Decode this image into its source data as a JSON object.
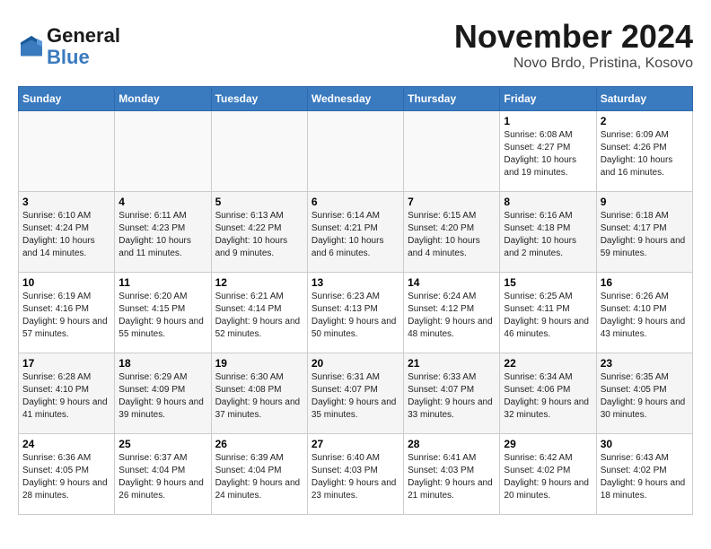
{
  "header": {
    "logo_line1": "General",
    "logo_line2": "Blue",
    "title": "November 2024",
    "subtitle": "Novo Brdo, Pristina, Kosovo"
  },
  "columns": [
    "Sunday",
    "Monday",
    "Tuesday",
    "Wednesday",
    "Thursday",
    "Friday",
    "Saturday"
  ],
  "weeks": [
    [
      {
        "day": "",
        "info": ""
      },
      {
        "day": "",
        "info": ""
      },
      {
        "day": "",
        "info": ""
      },
      {
        "day": "",
        "info": ""
      },
      {
        "day": "",
        "info": ""
      },
      {
        "day": "1",
        "info": "Sunrise: 6:08 AM\nSunset: 4:27 PM\nDaylight: 10 hours and 19 minutes."
      },
      {
        "day": "2",
        "info": "Sunrise: 6:09 AM\nSunset: 4:26 PM\nDaylight: 10 hours and 16 minutes."
      }
    ],
    [
      {
        "day": "3",
        "info": "Sunrise: 6:10 AM\nSunset: 4:24 PM\nDaylight: 10 hours and 14 minutes."
      },
      {
        "day": "4",
        "info": "Sunrise: 6:11 AM\nSunset: 4:23 PM\nDaylight: 10 hours and 11 minutes."
      },
      {
        "day": "5",
        "info": "Sunrise: 6:13 AM\nSunset: 4:22 PM\nDaylight: 10 hours and 9 minutes."
      },
      {
        "day": "6",
        "info": "Sunrise: 6:14 AM\nSunset: 4:21 PM\nDaylight: 10 hours and 6 minutes."
      },
      {
        "day": "7",
        "info": "Sunrise: 6:15 AM\nSunset: 4:20 PM\nDaylight: 10 hours and 4 minutes."
      },
      {
        "day": "8",
        "info": "Sunrise: 6:16 AM\nSunset: 4:18 PM\nDaylight: 10 hours and 2 minutes."
      },
      {
        "day": "9",
        "info": "Sunrise: 6:18 AM\nSunset: 4:17 PM\nDaylight: 9 hours and 59 minutes."
      }
    ],
    [
      {
        "day": "10",
        "info": "Sunrise: 6:19 AM\nSunset: 4:16 PM\nDaylight: 9 hours and 57 minutes."
      },
      {
        "day": "11",
        "info": "Sunrise: 6:20 AM\nSunset: 4:15 PM\nDaylight: 9 hours and 55 minutes."
      },
      {
        "day": "12",
        "info": "Sunrise: 6:21 AM\nSunset: 4:14 PM\nDaylight: 9 hours and 52 minutes."
      },
      {
        "day": "13",
        "info": "Sunrise: 6:23 AM\nSunset: 4:13 PM\nDaylight: 9 hours and 50 minutes."
      },
      {
        "day": "14",
        "info": "Sunrise: 6:24 AM\nSunset: 4:12 PM\nDaylight: 9 hours and 48 minutes."
      },
      {
        "day": "15",
        "info": "Sunrise: 6:25 AM\nSunset: 4:11 PM\nDaylight: 9 hours and 46 minutes."
      },
      {
        "day": "16",
        "info": "Sunrise: 6:26 AM\nSunset: 4:10 PM\nDaylight: 9 hours and 43 minutes."
      }
    ],
    [
      {
        "day": "17",
        "info": "Sunrise: 6:28 AM\nSunset: 4:10 PM\nDaylight: 9 hours and 41 minutes."
      },
      {
        "day": "18",
        "info": "Sunrise: 6:29 AM\nSunset: 4:09 PM\nDaylight: 9 hours and 39 minutes."
      },
      {
        "day": "19",
        "info": "Sunrise: 6:30 AM\nSunset: 4:08 PM\nDaylight: 9 hours and 37 minutes."
      },
      {
        "day": "20",
        "info": "Sunrise: 6:31 AM\nSunset: 4:07 PM\nDaylight: 9 hours and 35 minutes."
      },
      {
        "day": "21",
        "info": "Sunrise: 6:33 AM\nSunset: 4:07 PM\nDaylight: 9 hours and 33 minutes."
      },
      {
        "day": "22",
        "info": "Sunrise: 6:34 AM\nSunset: 4:06 PM\nDaylight: 9 hours and 32 minutes."
      },
      {
        "day": "23",
        "info": "Sunrise: 6:35 AM\nSunset: 4:05 PM\nDaylight: 9 hours and 30 minutes."
      }
    ],
    [
      {
        "day": "24",
        "info": "Sunrise: 6:36 AM\nSunset: 4:05 PM\nDaylight: 9 hours and 28 minutes."
      },
      {
        "day": "25",
        "info": "Sunrise: 6:37 AM\nSunset: 4:04 PM\nDaylight: 9 hours and 26 minutes."
      },
      {
        "day": "26",
        "info": "Sunrise: 6:39 AM\nSunset: 4:04 PM\nDaylight: 9 hours and 24 minutes."
      },
      {
        "day": "27",
        "info": "Sunrise: 6:40 AM\nSunset: 4:03 PM\nDaylight: 9 hours and 23 minutes."
      },
      {
        "day": "28",
        "info": "Sunrise: 6:41 AM\nSunset: 4:03 PM\nDaylight: 9 hours and 21 minutes."
      },
      {
        "day": "29",
        "info": "Sunrise: 6:42 AM\nSunset: 4:02 PM\nDaylight: 9 hours and 20 minutes."
      },
      {
        "day": "30",
        "info": "Sunrise: 6:43 AM\nSunset: 4:02 PM\nDaylight: 9 hours and 18 minutes."
      }
    ]
  ]
}
